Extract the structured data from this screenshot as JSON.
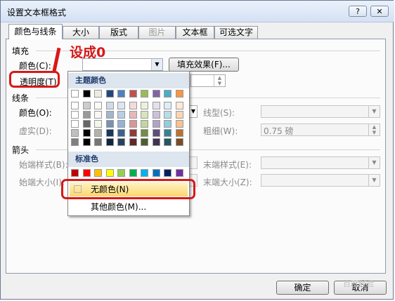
{
  "dialog": {
    "title": "设置文本框格式",
    "help_label": "?",
    "close_label": "✕"
  },
  "tabs": [
    {
      "label": "颜色与线条"
    },
    {
      "label": "大小"
    },
    {
      "label": "版式"
    },
    {
      "label": "图片"
    },
    {
      "label": "文本框"
    },
    {
      "label": "可选文字"
    }
  ],
  "fill": {
    "section_label": "填充",
    "color_label": "颜色(C):",
    "fill_effect_label": "填充效果(F)...",
    "transparency_label": "透明度(T)"
  },
  "line": {
    "section_label": "线条",
    "color_label": "颜色(O):",
    "dash_label": "虚实(D):",
    "style_label": "线型(S):",
    "weight_label": "粗细(W):",
    "weight_value": "0.75 磅"
  },
  "arrows": {
    "section_label": "箭头",
    "begin_style_label": "始端样式(B):",
    "end_style_label": "末端样式(E):",
    "begin_size_label": "始端大小(I):",
    "end_size_label": "末端大小(Z):"
  },
  "popup": {
    "theme_colors_label": "主题颜色",
    "standard_colors_label": "标准色",
    "no_color_label": "无颜色(N)",
    "more_colors_label": "其他颜色(M)...",
    "theme_colors": [
      "#ffffff",
      "#000000",
      "#eeece1",
      "#1f497d",
      "#4f81bd",
      "#c0504d",
      "#9bbb59",
      "#8064a2",
      "#4bacc6",
      "#f79646"
    ],
    "standard_colors": [
      "#c00000",
      "#ff0000",
      "#ffc000",
      "#ffff00",
      "#92d050",
      "#00b050",
      "#00b0f0",
      "#0070c0",
      "#002060",
      "#7030a0"
    ]
  },
  "buttons": {
    "ok_label": "确定",
    "cancel_label": "取消"
  },
  "annotation": {
    "text": "设成0"
  },
  "watermark": {
    "text": "百度经验"
  },
  "accent_color": "#d81818"
}
